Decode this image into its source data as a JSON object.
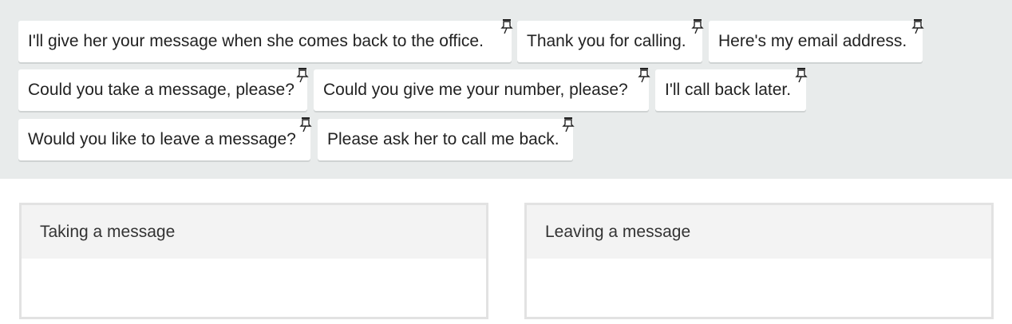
{
  "phrases": [
    {
      "text": "I'll give her your message when she comes back to the office."
    },
    {
      "text": "Thank you for calling."
    },
    {
      "text": "Here's my email address."
    },
    {
      "text": "Could you take a message, please?"
    },
    {
      "text": "Could you give me your number, please?"
    },
    {
      "text": "I'll call back later."
    },
    {
      "text": "Would you like to leave a message?"
    },
    {
      "text": "Please ask her to call me back."
    }
  ],
  "pin_icon": "pushpin-icon",
  "categories": [
    {
      "title": "Taking a message"
    },
    {
      "title": "Leaving a message"
    }
  ]
}
